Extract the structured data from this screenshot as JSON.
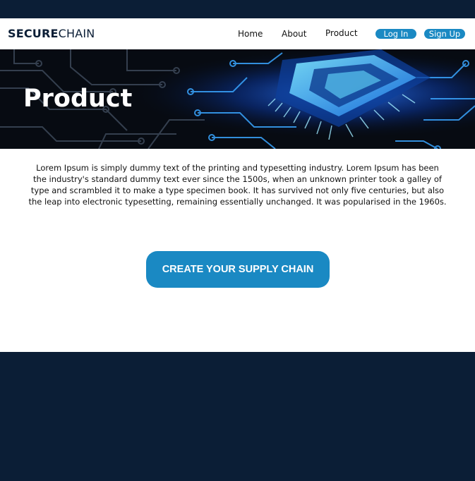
{
  "brand": {
    "bold": "SECURE",
    "light": "CHAIN"
  },
  "nav": {
    "home": "Home",
    "about": "About",
    "product": "Product",
    "login": "Log In",
    "signup": "Sign Up"
  },
  "hero": {
    "title": "Product"
  },
  "main": {
    "intro": "Lorem Ipsum is simply dummy text of the printing and typesetting industry. Lorem Ipsum has been the industry's standard dummy text ever since the 1500s, when an unknown printer took a galley of type and scrambled it to make a type specimen book. It has survived not only five centuries, but also the leap into electronic typesetting, remaining essentially unchanged. It was popularised in the 1960s.",
    "cta": "CREATE YOUR SUPPLY CHAIN"
  },
  "colors": {
    "navy": "#0b1e36",
    "accent": "#1a89c3",
    "circuit": "#3aa6ff"
  },
  "icons": {
    "hero_image": "circuit-board-chip-image"
  }
}
